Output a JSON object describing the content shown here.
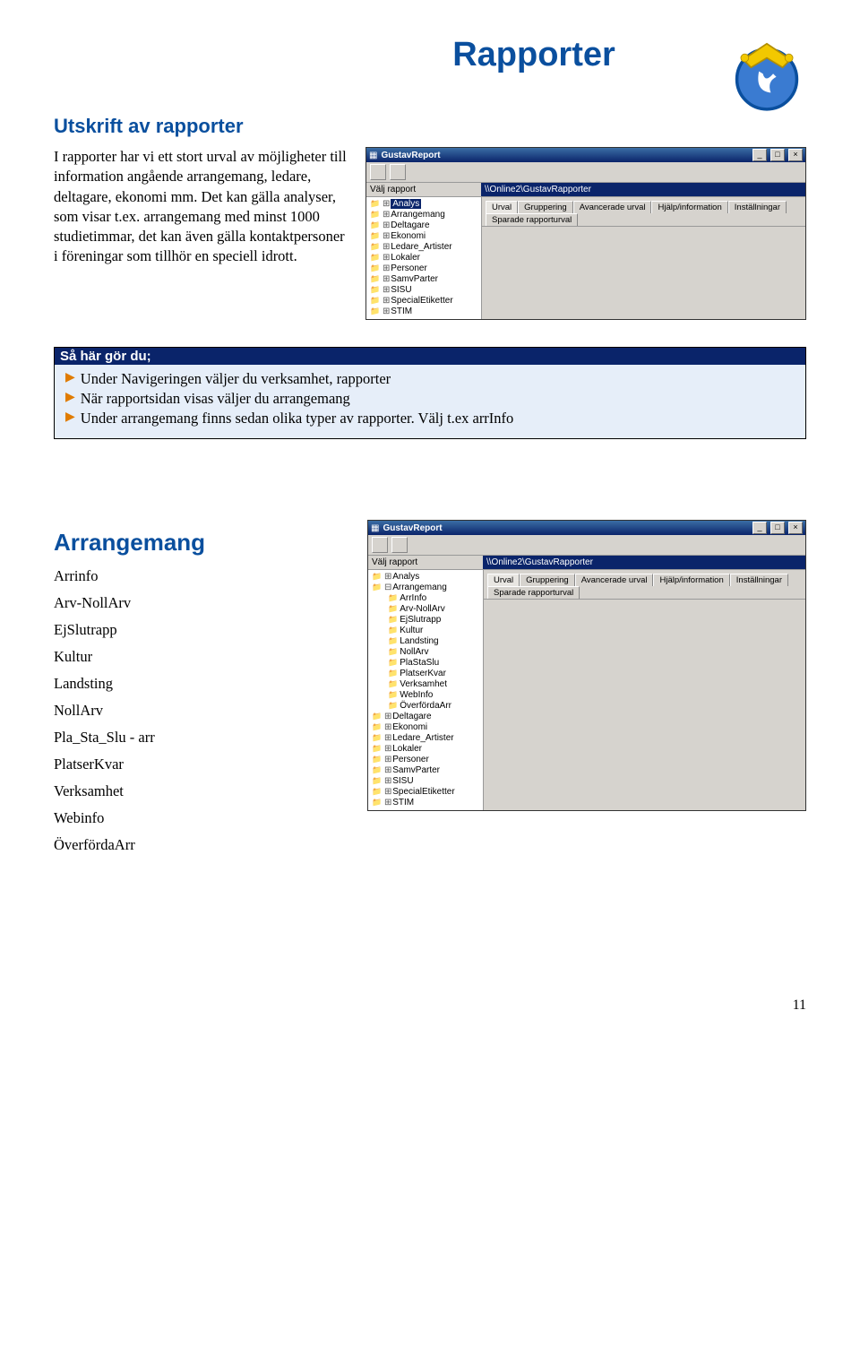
{
  "header": {
    "page_title": "Rapporter",
    "subtitle": "Utskrift av rapporter"
  },
  "intro_paragraph": "I rapporter har vi ett stort urval av möjligheter till information angående arrangemang, ledare, deltagare, ekonomi mm. Det kan gälla analyser, som visar t.ex. arrangemang med minst 1000 studietimmar, det kan även gälla kontaktpersoner i föreningar som tillhör en speciell idrott.",
  "app1": {
    "title": "GustavReport",
    "info_left": "Välj rapport",
    "info_right": "\\\\Online2\\GustavRapporter",
    "tree": [
      "Analys",
      "Arrangemang",
      "Deltagare",
      "Ekonomi",
      "Ledare_Artister",
      "Lokaler",
      "Personer",
      "SamvParter",
      "SISU",
      "SpecialEtiketter",
      "STIM"
    ],
    "selected": "Analys",
    "tabs": [
      "Urval",
      "Gruppering",
      "Avancerade urval",
      "Hjälp/information",
      "Inställningar",
      "Sparade rapporturval"
    ]
  },
  "instructions": {
    "header": "Så här gör du;",
    "steps": [
      "Under Navigeringen väljer du verksamhet, rapporter",
      "När rapportsidan visas väljer du arrangemang",
      "Under arrangemang finns sedan olika typer av rapporter. Välj t.ex arrInfo"
    ]
  },
  "section2": {
    "title": "Arrangemang",
    "items": [
      "Arrinfo",
      "Arv-NollArv",
      "EjSlutrapp",
      "Kultur",
      "Landsting",
      "NollArv",
      "Pla_Sta_Slu - arr",
      "PlatserKvar",
      "Verksamhet",
      "Webinfo",
      "ÖverfördaArr"
    ]
  },
  "app2": {
    "title": "GustavReport",
    "info_left": "Välj rapport",
    "info_right": "\\\\Online2\\GustavRapporter",
    "tree_top": [
      {
        "label": "Analys",
        "open": false
      },
      {
        "label": "Arrangemang",
        "open": true,
        "children": [
          "ArrInfo",
          "Arv-NollArv",
          "EjSlutrapp",
          "Kultur",
          "Landsting",
          "NollArv",
          "PlaStaSlu",
          "PlatserKvar",
          "Verksamhet",
          "WebInfo",
          "ÖverfördaArr"
        ]
      },
      {
        "label": "Deltagare"
      },
      {
        "label": "Ekonomi"
      },
      {
        "label": "Ledare_Artister"
      },
      {
        "label": "Lokaler"
      },
      {
        "label": "Personer"
      },
      {
        "label": "SamvParter"
      },
      {
        "label": "SISU"
      },
      {
        "label": "SpecialEtiketter"
      },
      {
        "label": "STIM"
      }
    ],
    "tabs": [
      "Urval",
      "Gruppering",
      "Avancerade urval",
      "Hjälp/information",
      "Inställningar",
      "Sparade rapporturval"
    ]
  },
  "page_number": "11"
}
